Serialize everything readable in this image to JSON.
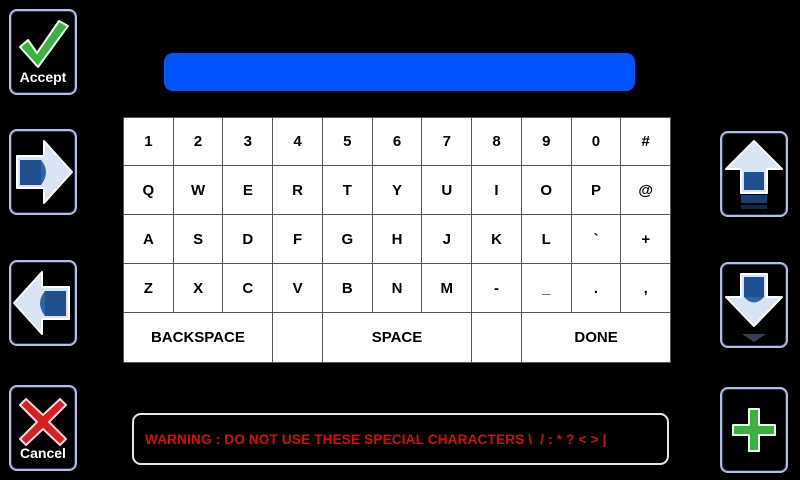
{
  "side_buttons": {
    "accept_label": "Accept",
    "cancel_label": "Cancel"
  },
  "keyboard": {
    "rows": [
      [
        "1",
        "2",
        "3",
        "4",
        "5",
        "6",
        "7",
        "8",
        "9",
        "0",
        "#"
      ],
      [
        "Q",
        "W",
        "E",
        "R",
        "T",
        "Y",
        "U",
        "I",
        "O",
        "P",
        "@"
      ],
      [
        "A",
        "S",
        "D",
        "F",
        "G",
        "H",
        "J",
        "K",
        "L",
        "`",
        "+"
      ],
      [
        "Z",
        "X",
        "C",
        "V",
        "B",
        "N",
        "M",
        "-",
        "_",
        ".",
        ","
      ]
    ],
    "backspace_label": "BACKSPACE",
    "space_label": "SPACE",
    "done_label": "DONE"
  },
  "text_field": {
    "value": ""
  },
  "warning": {
    "text": "WARNING : DO NOT USE THESE SPECIAL CHARACTERS \\  / : * ? < > |"
  },
  "colors": {
    "background": "#000000",
    "text_field": "#0055ff",
    "warning_text": "#d01010",
    "accept_check": "#3cb043",
    "cancel_x": "#d62020",
    "arrow_blue": "#1f4f8f",
    "plus_green": "#3cb043"
  },
  "icons": {
    "accept": "check-icon",
    "cancel": "x-icon",
    "nav_right": "arrow-right-icon",
    "nav_left": "arrow-left-icon",
    "scroll_up": "arrow-up-icon",
    "scroll_down": "arrow-down-icon",
    "add": "plus-icon"
  }
}
